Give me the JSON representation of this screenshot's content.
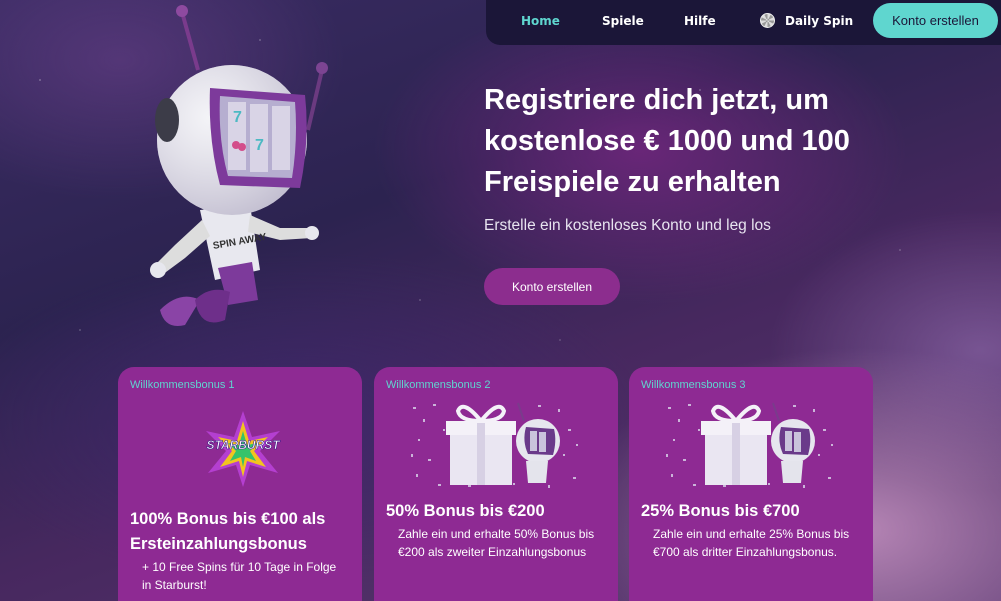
{
  "nav": {
    "home": "Home",
    "spiele": "Spiele",
    "hilfe": "Hilfe",
    "daily_spin": "Daily Spin",
    "cta": "Konto erstellen"
  },
  "hero": {
    "title": "Registriere dich jetzt, um kostenlose € 1000 und 100 Freispiele zu erhalten",
    "subtitle": "Erstelle ein kostenloses Konto und leg los",
    "cta": "Konto erstellen",
    "robot_badge": "SPIN AWAY"
  },
  "cards": [
    {
      "label": "Willkommensbonus 1",
      "logo_text": "STARBURST",
      "title": "100% Bonus bis €100 als Ersteinzahlungsbonus",
      "text": "+ 10 Free Spins für 10 Tage in Folge in Starburst!"
    },
    {
      "label": "Willkommensbonus 2",
      "title": "50% Bonus bis €200",
      "text": "Zahle ein und erhalte 50% Bonus bis €200 als zweiter Einzahlungsbonus"
    },
    {
      "label": "Willkommensbonus 3",
      "title": "25% Bonus bis €700",
      "text": "Zahle ein und erhalte 25% Bonus bis €700 als dritter Einzahlungsbonus."
    }
  ],
  "colors": {
    "accent": "#5fd6cf",
    "card": "#8e2a93",
    "cta": "#8c2d8e",
    "nav_bg": "#1b1638"
  }
}
